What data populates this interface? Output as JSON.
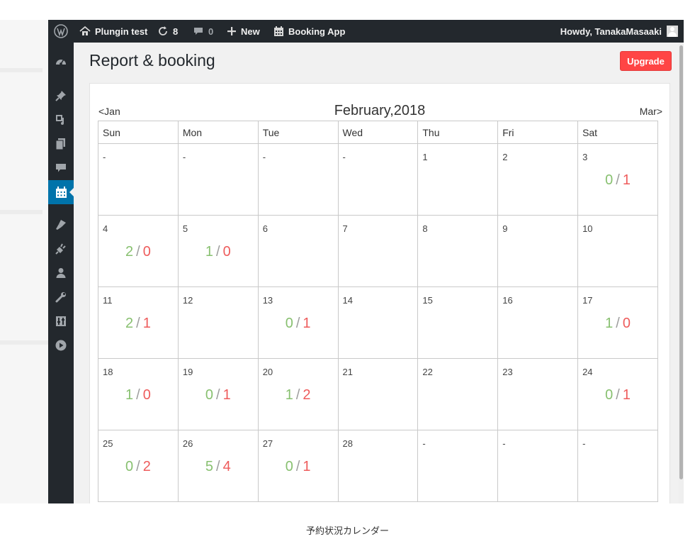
{
  "adminbar": {
    "site_name": "Plungin test",
    "updates_count": "8",
    "comments_count": "0",
    "new_label": "New",
    "plugin_label": "Booking App",
    "howdy": "Howdy, TanakaMasaaki"
  },
  "page": {
    "title": "Report & booking",
    "upgrade_label": "Upgrade"
  },
  "calendar": {
    "prev_label": "<Jan",
    "next_label": "Mar>",
    "month_title": "February,2018",
    "weekdays": [
      "Sun",
      "Mon",
      "Tue",
      "Wed",
      "Thu",
      "Fri",
      "Sat"
    ],
    "weeks": [
      [
        {
          "day": "-"
        },
        {
          "day": "-"
        },
        {
          "day": "-"
        },
        {
          "day": "-"
        },
        {
          "day": "1"
        },
        {
          "day": "2"
        },
        {
          "day": "3",
          "a": "0",
          "b": "1"
        }
      ],
      [
        {
          "day": "4",
          "a": "2",
          "b": "0"
        },
        {
          "day": "5",
          "a": "1",
          "b": "0"
        },
        {
          "day": "6"
        },
        {
          "day": "7"
        },
        {
          "day": "8"
        },
        {
          "day": "9"
        },
        {
          "day": "10"
        }
      ],
      [
        {
          "day": "11",
          "a": "2",
          "b": "1"
        },
        {
          "day": "12"
        },
        {
          "day": "13",
          "a": "0",
          "b": "1"
        },
        {
          "day": "14"
        },
        {
          "day": "15"
        },
        {
          "day": "16"
        },
        {
          "day": "17",
          "a": "1",
          "b": "0"
        }
      ],
      [
        {
          "day": "18",
          "a": "1",
          "b": "0"
        },
        {
          "day": "19",
          "a": "0",
          "b": "1"
        },
        {
          "day": "20",
          "a": "1",
          "b": "2"
        },
        {
          "day": "21"
        },
        {
          "day": "22"
        },
        {
          "day": "23"
        },
        {
          "day": "24",
          "a": "0",
          "b": "1"
        }
      ],
      [
        {
          "day": "25",
          "a": "0",
          "b": "2"
        },
        {
          "day": "26",
          "a": "5",
          "b": "4"
        },
        {
          "day": "27",
          "a": "0",
          "b": "1"
        },
        {
          "day": "28"
        },
        {
          "day": "-"
        },
        {
          "day": "-"
        },
        {
          "day": "-"
        }
      ]
    ],
    "separator": "/",
    "available_color": "#88c070",
    "booked_color": "#ee5c5c"
  },
  "caption": "予約状況カレンダー",
  "colors": {
    "adminbar_bg": "#23282d",
    "active_menu": "#0073aa",
    "upgrade_bg": "#ff4545"
  },
  "icons": {
    "adminbar": [
      "wordpress-logo-icon",
      "home-icon",
      "updates-icon",
      "comments-icon",
      "plus-icon",
      "calendar-icon"
    ],
    "sidebar": [
      "dashboard-icon",
      "pin-icon",
      "media-icon",
      "pages-icon",
      "comments-icon",
      "calendar-icon",
      "appearance-icon",
      "plugins-icon",
      "users-icon",
      "tools-icon",
      "settings-icon",
      "play-icon"
    ]
  }
}
